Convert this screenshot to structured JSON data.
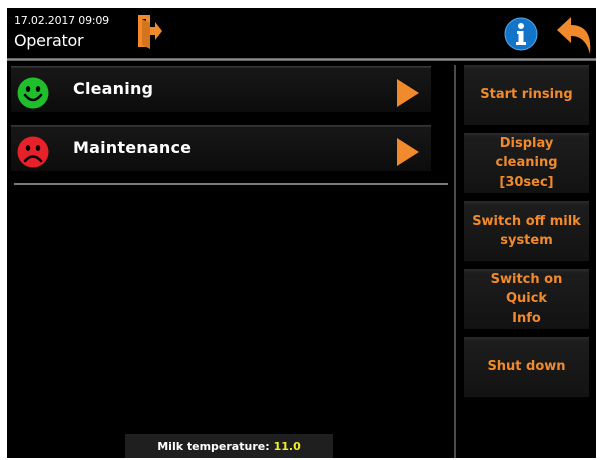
{
  "header": {
    "datetime": "17.02.2017 09:09",
    "role": "Operator",
    "icons": {
      "logout": "logout-door-icon",
      "info": "info-icon",
      "back": "back-arrow-icon"
    }
  },
  "menu": {
    "items": [
      {
        "label": "Cleaning",
        "status": "ok",
        "status_icon": "smiley-happy-icon",
        "arrow_icon": "play-arrow-icon"
      },
      {
        "label": "Maintenance",
        "status": "warning",
        "status_icon": "smiley-sad-icon",
        "arrow_icon": "play-arrow-icon"
      }
    ]
  },
  "actions": [
    {
      "lines": [
        "Start rinsing"
      ]
    },
    {
      "lines": [
        "Display cleaning",
        "[30sec]"
      ]
    },
    {
      "lines": [
        "Switch off milk",
        "system"
      ]
    },
    {
      "lines": [
        "Switch on Quick",
        "Info"
      ]
    },
    {
      "lines": [
        "Shut down"
      ]
    }
  ],
  "footer": {
    "milk_temp_label": "Milk temperature:",
    "milk_temp_value": "11.0"
  },
  "colors": {
    "accent_orange": "#f08a2c",
    "ok_green": "#1fbf2c",
    "warning_red": "#e8202a",
    "info_blue": "#1275c9",
    "temp_value": "#f2ee2a"
  }
}
